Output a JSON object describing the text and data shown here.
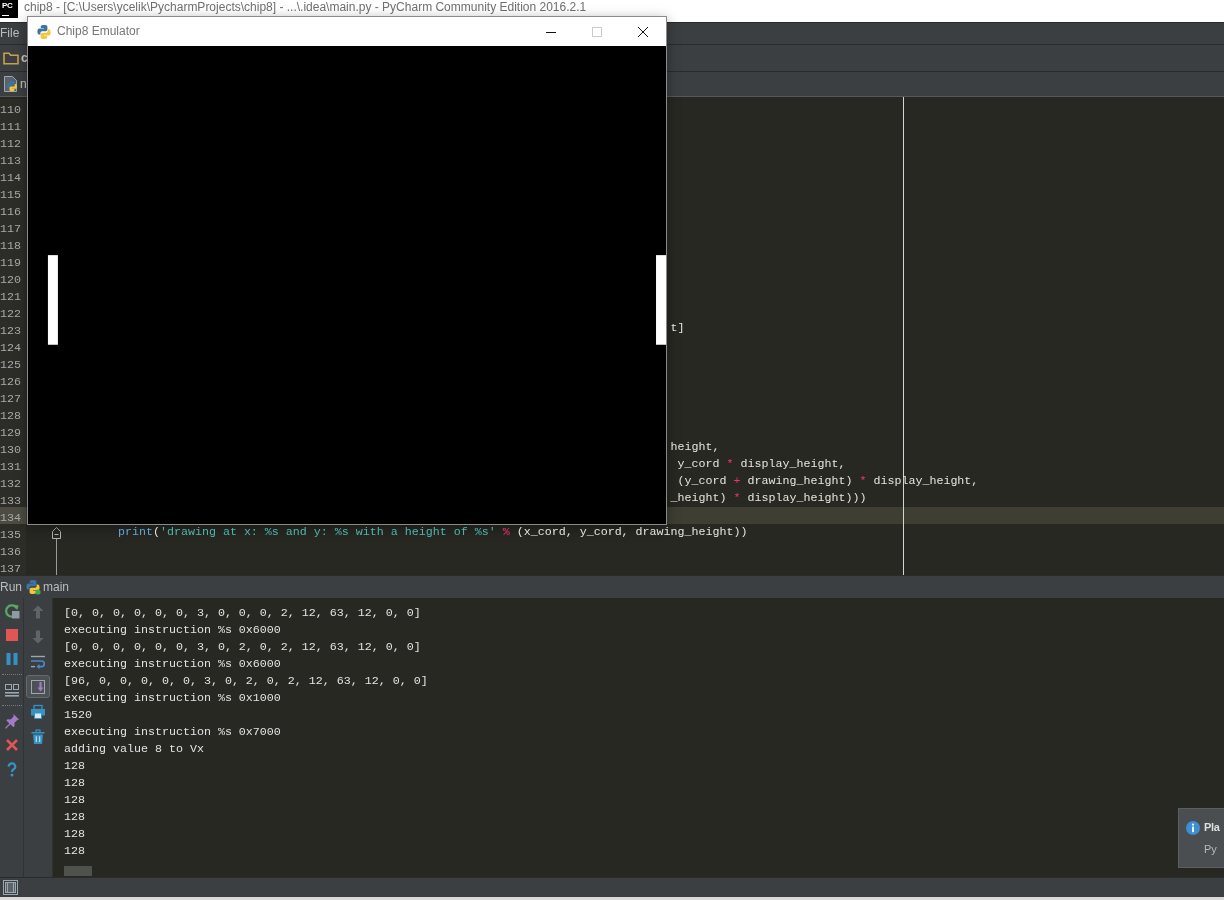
{
  "window": {
    "logo_text": "PC",
    "title": "chip8 - [C:\\Users\\ycelik\\PycharmProjects\\chip8] - ...\\.idea\\main.py - PyCharm Community Edition 2016.2.1"
  },
  "menu_bar": {
    "items": [
      "File"
    ]
  },
  "navigation_bar": {
    "items": [
      "c"
    ]
  },
  "editor_tabs": [
    {
      "label": "n"
    }
  ],
  "editor": {
    "lines": [
      {
        "number": "110",
        "current": false,
        "fold_marker": false
      },
      {
        "number": "111",
        "current": false,
        "fold_marker": false
      },
      {
        "number": "112",
        "current": false,
        "fold_marker": false
      },
      {
        "number": "113",
        "current": false,
        "fold_marker": false
      },
      {
        "number": "114",
        "current": false,
        "fold_marker": false
      },
      {
        "number": "115",
        "current": false,
        "fold_marker": false
      },
      {
        "number": "116",
        "current": false,
        "fold_marker": false
      },
      {
        "number": "117",
        "current": false,
        "fold_marker": false
      },
      {
        "number": "118",
        "current": false,
        "fold_marker": false
      },
      {
        "number": "119",
        "current": false,
        "fold_marker": false
      },
      {
        "number": "120",
        "current": false,
        "fold_marker": false
      },
      {
        "number": "121",
        "current": false,
        "fold_marker": false
      },
      {
        "number": "122",
        "current": false,
        "fold_marker": false
      },
      {
        "number": "123",
        "current": false,
        "fold_marker": false,
        "partly_hidden": true,
        "indented": false,
        "code": [
          {
            "kind": "plain",
            "text": "t]"
          }
        ]
      },
      {
        "number": "124",
        "current": false,
        "fold_marker": false
      },
      {
        "number": "125",
        "current": false,
        "fold_marker": false
      },
      {
        "number": "126",
        "current": false,
        "fold_marker": false
      },
      {
        "number": "127",
        "current": false,
        "fold_marker": false
      },
      {
        "number": "128",
        "current": false,
        "fold_marker": false
      },
      {
        "number": "129",
        "current": false,
        "fold_marker": false
      },
      {
        "number": "130",
        "current": false,
        "fold_marker": false,
        "partly_hidden": true,
        "indented": false,
        "code": [
          {
            "kind": "plain",
            "text": "height,"
          }
        ]
      },
      {
        "number": "131",
        "current": false,
        "fold_marker": false,
        "partly_hidden": true,
        "indented": false,
        "code": [
          {
            "kind": "plain",
            "text": " y_cord "
          },
          {
            "kind": "operator",
            "text": "*"
          },
          {
            "kind": "plain",
            "text": " display_height,"
          }
        ]
      },
      {
        "number": "132",
        "current": false,
        "fold_marker": false,
        "partly_hidden": true,
        "indented": false,
        "code": [
          {
            "kind": "plain",
            "text": " (y_cord "
          },
          {
            "kind": "operator",
            "text": "+"
          },
          {
            "kind": "plain",
            "text": " drawing_height) "
          },
          {
            "kind": "operator",
            "text": "*"
          },
          {
            "kind": "plain",
            "text": " display_height,"
          }
        ]
      },
      {
        "number": "133",
        "current": false,
        "fold_marker": false,
        "partly_hidden": true,
        "indented": false,
        "code": [
          {
            "kind": "plain",
            "text": "_height) "
          },
          {
            "kind": "operator",
            "text": "*"
          },
          {
            "kind": "plain",
            "text": " display_height)))"
          }
        ]
      },
      {
        "number": "134",
        "current": true,
        "fold_marker": false
      },
      {
        "number": "135",
        "current": false,
        "fold_marker": true,
        "partly_hidden": false,
        "indented": true,
        "code": [
          {
            "kind": "builtin",
            "text": "print"
          },
          {
            "kind": "plain",
            "text": "("
          },
          {
            "kind": "string",
            "text": "'drawing at x: %s and y: %s with a height of %s'"
          },
          {
            "kind": "operator",
            "text": " %"
          },
          {
            "kind": "plain",
            "text": " (x_cord, y_cord, drawing_height))"
          }
        ]
      },
      {
        "number": "136",
        "current": false,
        "fold_marker": false
      },
      {
        "number": "137",
        "current": false,
        "fold_marker": false
      }
    ]
  },
  "emulator_window": {
    "title": "Chip8 Emulator",
    "maximize_disabled": true
  },
  "run_panel": {
    "title": "Run",
    "tab": "main",
    "console_toolbar": [
      {
        "disabled": true,
        "pressed": false
      },
      {
        "disabled": true,
        "pressed": false
      },
      {
        "disabled": false,
        "pressed": false
      },
      {
        "disabled": false,
        "pressed": true
      },
      {
        "disabled": false,
        "pressed": false
      },
      {
        "disabled": false,
        "pressed": false
      }
    ],
    "console_lines": [
      "[0, 0, 0, 0, 0, 0, 3, 0, 0, 0, 2, 12, 63, 12, 0, 0]",
      "executing instruction %s 0x6000",
      "[0, 0, 0, 0, 0, 0, 3, 0, 2, 0, 2, 12, 63, 12, 0, 0]",
      "executing instruction %s 0x6000",
      "[96, 0, 0, 0, 0, 0, 3, 0, 2, 0, 2, 12, 63, 12, 0, 0]",
      "executing instruction %s 0x1000",
      "1520",
      "executing instruction %s 0x7000",
      "adding value 8 to Vx",
      "128",
      "128",
      "128",
      "128",
      "128",
      "128"
    ]
  },
  "notification": {
    "title": "Pla",
    "text": "Py"
  }
}
